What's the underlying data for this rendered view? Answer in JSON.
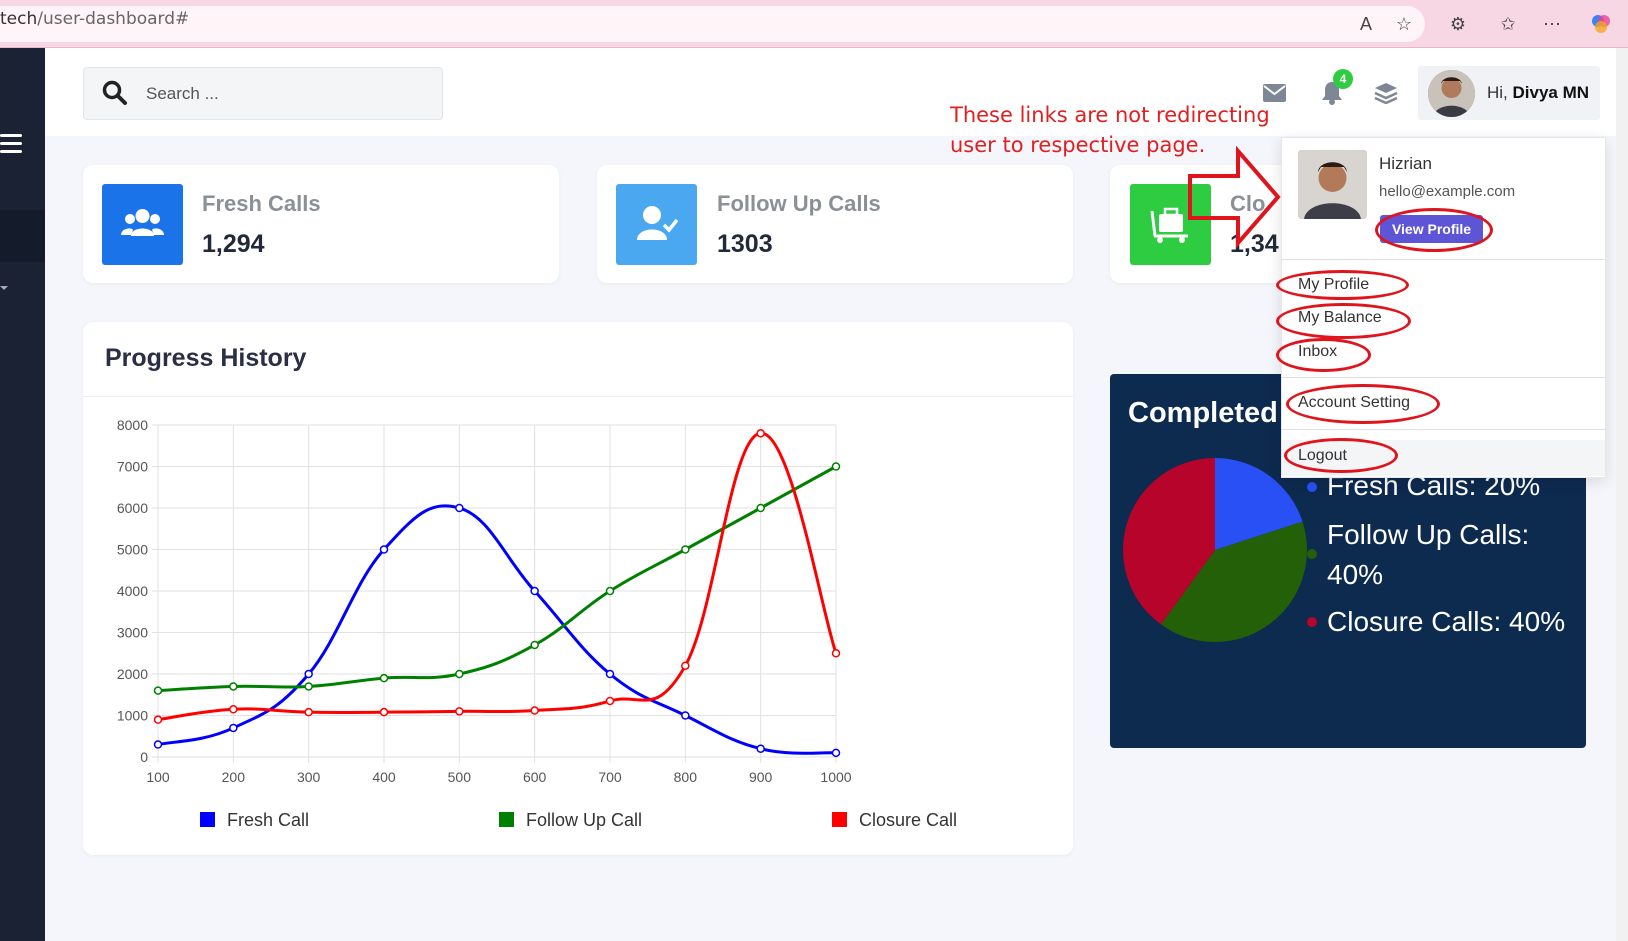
{
  "browser": {
    "url_prefix": "tech",
    "url_path": "/user-dashboard#",
    "icons": [
      "read-aloud-icon",
      "favorite-star-icon",
      "extensions-icon",
      "favorites-icon",
      "more-icon",
      "copilot-icon"
    ]
  },
  "header": {
    "search_placeholder": "Search ...",
    "notification_count": "4",
    "greeting": "Hi, ",
    "user_name": "Divya MN"
  },
  "stats": [
    {
      "label": "Fresh Calls",
      "value": "1,294",
      "color": "#1a73e8",
      "icon": "users-icon"
    },
    {
      "label": "Follow Up Calls",
      "value": "1303",
      "color": "#4aa8f0",
      "icon": "user-check-icon"
    },
    {
      "label": "Clo",
      "value": "1,34",
      "color": "#2ecc40",
      "icon": "luggage-cart-icon"
    }
  ],
  "progress": {
    "title": "Progress History"
  },
  "chart_data": [
    {
      "type": "line",
      "title": "Progress History",
      "x": [
        100,
        200,
        300,
        400,
        500,
        600,
        700,
        800,
        900,
        1000
      ],
      "ylim": [
        0,
        8000
      ],
      "yticks": [
        0,
        1000,
        2000,
        3000,
        4000,
        5000,
        6000,
        7000,
        8000
      ],
      "grid": true,
      "legend": "bottom",
      "series": [
        {
          "name": "Fresh Call",
          "color": "#0000ff",
          "values": [
            300,
            700,
            2000,
            5000,
            6000,
            4000,
            2000,
            1000,
            200,
            100
          ]
        },
        {
          "name": "Follow Up Call",
          "color": "#008000",
          "values": [
            1600,
            1700,
            1700,
            1900,
            2000,
            2700,
            4000,
            5000,
            6000,
            7000
          ]
        },
        {
          "name": "Closure Call",
          "color": "#ff0000",
          "values": [
            900,
            1150,
            1080,
            1080,
            1100,
            1120,
            1350,
            2200,
            7800,
            2500
          ]
        }
      ]
    },
    {
      "type": "pie",
      "title": "Completed",
      "slices": [
        {
          "label": "Fresh Calls: 20%",
          "value": 20,
          "color": "#2850f5"
        },
        {
          "label": "Follow Up Calls: 40%",
          "value": 40,
          "color": "#236007"
        },
        {
          "label": "Closure Calls: 40%",
          "value": 40,
          "color": "#b7042a"
        }
      ]
    }
  ],
  "completed": {
    "title": "Completed",
    "legend": [
      {
        "line1": "Fresh Calls: 20%",
        "line2": "",
        "color": "#2850f5"
      },
      {
        "line1": "Follow Up Calls:",
        "line2": "40%",
        "color": "#236007"
      },
      {
        "line1": "Closure Calls: 40%",
        "line2": "",
        "color": "#b7042a"
      }
    ]
  },
  "dropdown": {
    "name": "Hizrian",
    "email": "hello@example.com",
    "view_profile": "View Profile",
    "items": [
      "My Profile",
      "My Balance",
      "Inbox",
      "Account Setting",
      "Logout"
    ]
  },
  "annotation": {
    "line1": "These links are not redirecting",
    "line2": "user to respective page.",
    "color": "#e02020"
  }
}
